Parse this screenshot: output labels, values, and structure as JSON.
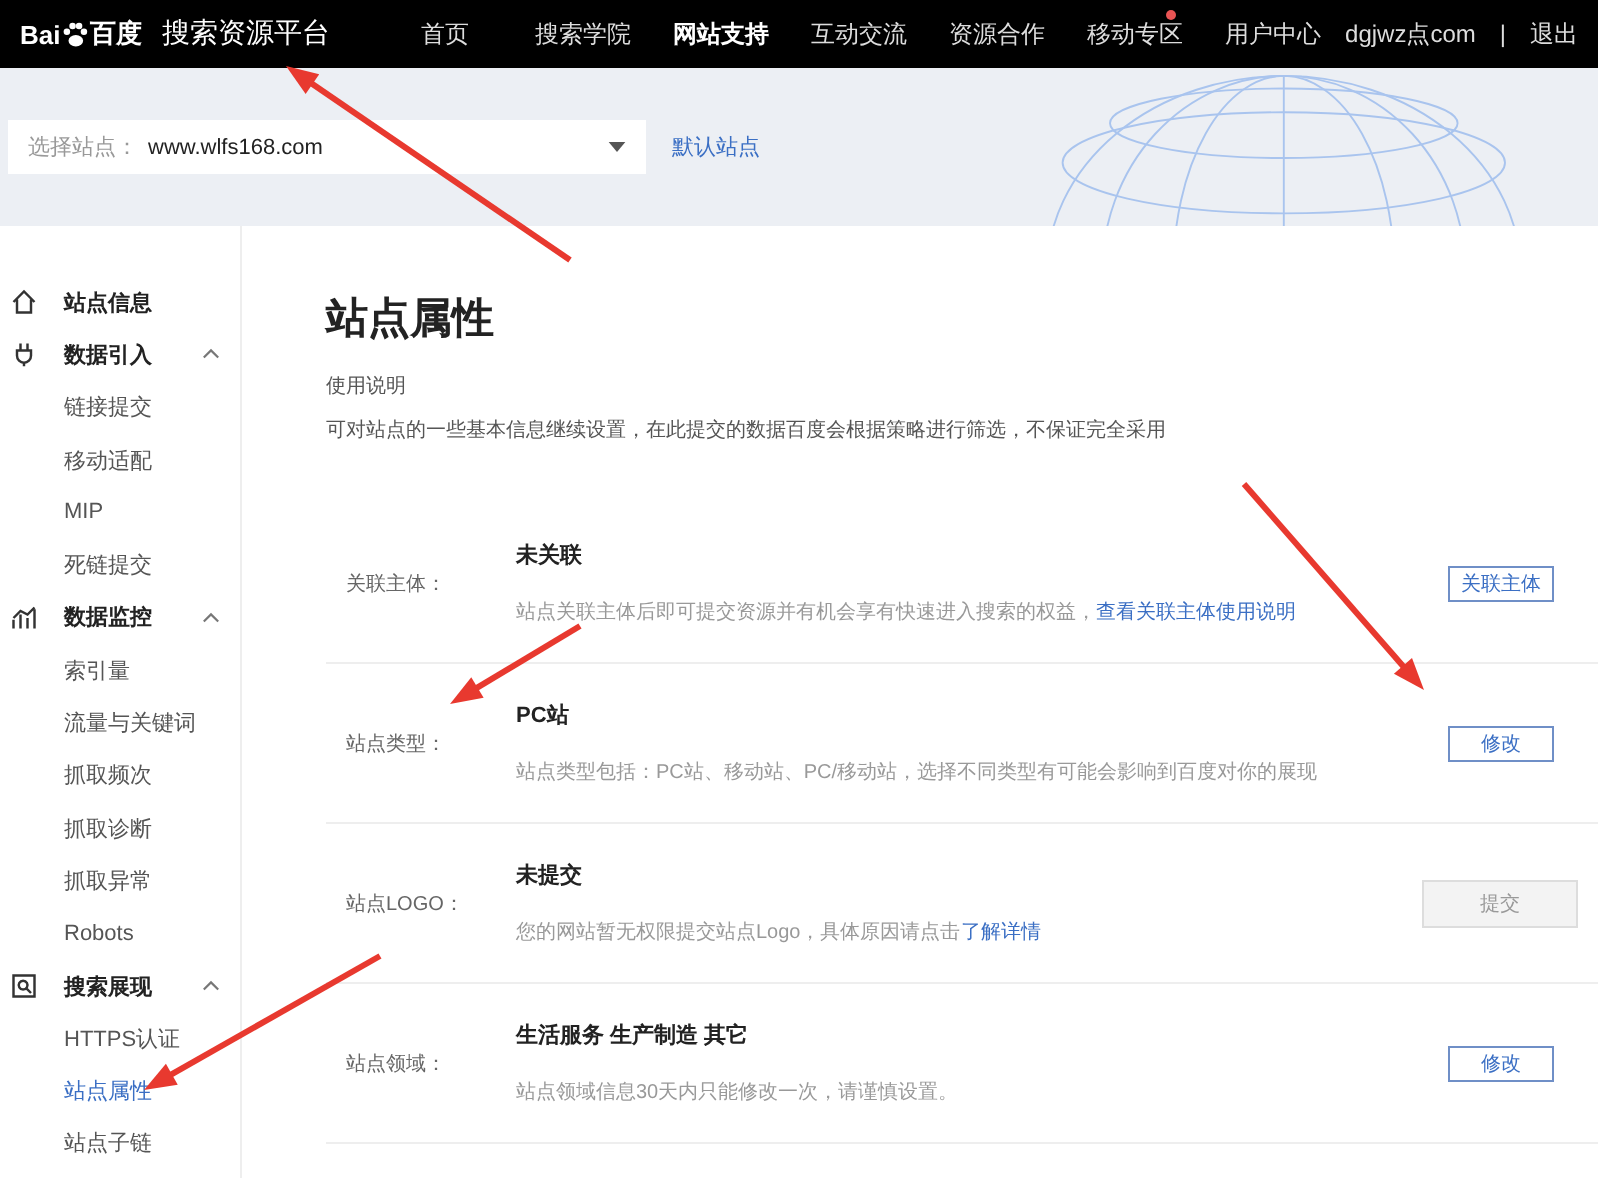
{
  "topbar": {
    "logo": "Bai",
    "logo_suffix": "百度",
    "platform": "搜索资源平台",
    "nav": [
      {
        "label": "首页",
        "selected": false,
        "badge": false
      },
      {
        "label": "搜索学院",
        "selected": false,
        "badge": false
      },
      {
        "label": "网站支持",
        "selected": true,
        "badge": false
      },
      {
        "label": "互动交流",
        "selected": false,
        "badge": false
      },
      {
        "label": "资源合作",
        "selected": false,
        "badge": false
      },
      {
        "label": "移动专区",
        "selected": false,
        "badge": true
      },
      {
        "label": "用户中心",
        "selected": false,
        "badge": false
      }
    ],
    "user": "dgjwz点com",
    "separator": "|",
    "logout": "退出"
  },
  "site_selector": {
    "label": "选择站点：",
    "value": "www.wlfs168.com",
    "default_link": "默认站点"
  },
  "sidebar": {
    "groups": [
      {
        "label": "站点信息"
      },
      {
        "label": "数据引入",
        "expanded": true,
        "children": [
          {
            "label": "链接提交",
            "selected": false
          },
          {
            "label": "移动适配",
            "selected": false
          },
          {
            "label": "MIP",
            "selected": false
          },
          {
            "label": "死链提交",
            "selected": false
          }
        ]
      },
      {
        "label": "数据监控",
        "expanded": true,
        "children": [
          {
            "label": "索引量",
            "selected": false
          },
          {
            "label": "流量与关键词",
            "selected": false
          },
          {
            "label": "抓取频次",
            "selected": false
          },
          {
            "label": "抓取诊断",
            "selected": false
          },
          {
            "label": "抓取异常",
            "selected": false
          },
          {
            "label": "Robots",
            "selected": false
          }
        ]
      },
      {
        "label": "搜索展现",
        "expanded": true,
        "children": [
          {
            "label": "HTTPS认证",
            "selected": false
          },
          {
            "label": "站点属性",
            "selected": true
          },
          {
            "label": "站点子链",
            "selected": false
          }
        ]
      }
    ]
  },
  "page": {
    "title": "站点属性",
    "help_title": "使用说明",
    "help_text": "可对站点的一些基本信息继续设置，在此提交的数据百度会根据策略进行筛选，不保证完全采用",
    "rows": [
      {
        "label": "关联主体：",
        "value": "未关联",
        "desc": "站点关联主体后即可提交资源并有机会享有快速进入搜索的权益，",
        "link": "查看关联主体使用说明",
        "button": {
          "label": "关联主体",
          "disabled": false
        }
      },
      {
        "label": "站点类型：",
        "value": "PC站",
        "desc": "站点类型包括：PC站、移动站、PC/移动站，选择不同类型有可能会影响到百度对你的展现",
        "button": {
          "label": "修改",
          "disabled": false
        }
      },
      {
        "label": "站点LOGO：",
        "value": "未提交",
        "desc": "您的网站暂无权限提交站点Logo，具体原因请点击",
        "link": "了解详情",
        "button": {
          "label": "提交",
          "disabled": true
        }
      },
      {
        "label": "站点领域：",
        "value": "生活服务 生产制造 其它",
        "desc": "站点领域信息30天内只能修改一次，请谨慎设置。",
        "button": {
          "label": "修改",
          "disabled": false
        }
      }
    ]
  }
}
